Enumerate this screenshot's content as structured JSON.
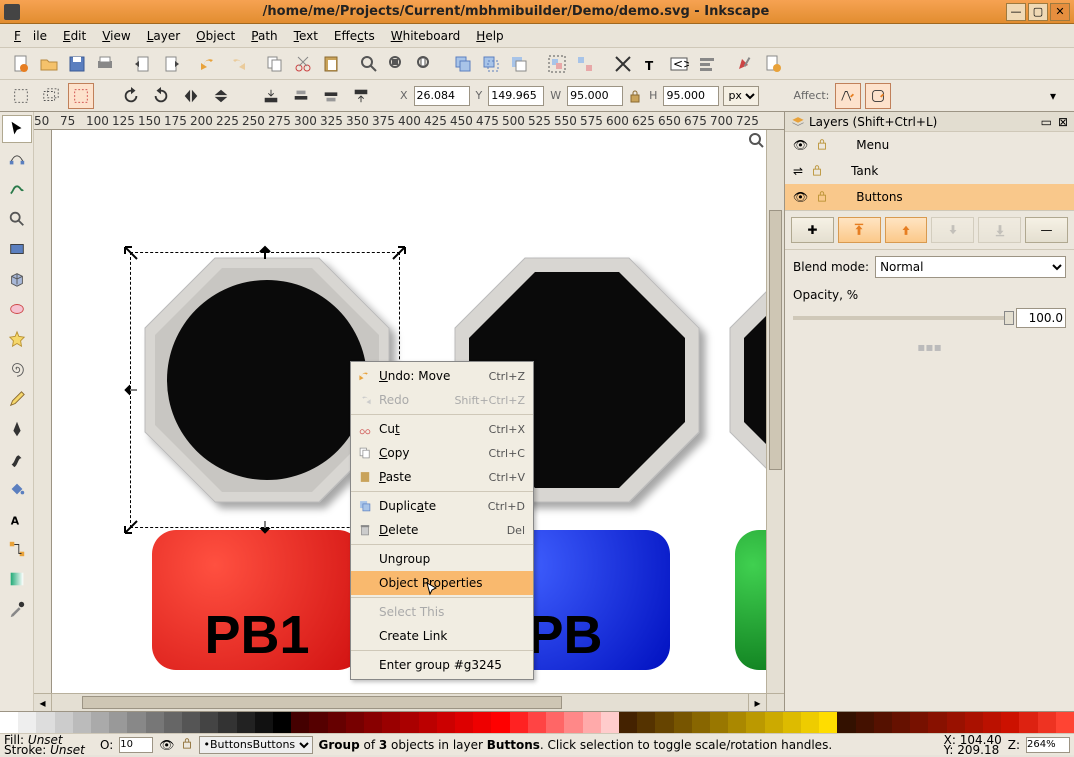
{
  "window": {
    "title": "/home/me/Projects/Current/mbhmibuilder/Demo/demo.svg - Inkscape"
  },
  "menu": {
    "file": "File",
    "edit": "Edit",
    "view": "View",
    "layer": "Layer",
    "object": "Object",
    "path": "Path",
    "text": "Text",
    "effects": "Effects",
    "whiteboard": "Whiteboard",
    "help": "Help"
  },
  "tb2": {
    "x_label": "X",
    "x_value": "26.084",
    "y_label": "Y",
    "y_value": "149.965",
    "w_label": "W",
    "w_value": "95.000",
    "h_label": "H",
    "h_value": "95.000",
    "unit": "px",
    "affect_label": "Affect:"
  },
  "layers_panel": {
    "title": "Layers (Shift+Ctrl+L)",
    "items": [
      {
        "name": "Menu"
      },
      {
        "name": "Tank"
      },
      {
        "name": "Buttons"
      }
    ],
    "blend_label": "Blend mode:",
    "blend_value": "Normal",
    "opacity_label": "Opacity, %",
    "opacity_value": "100.0"
  },
  "context_menu": {
    "undo": "Undo: Move",
    "undo_acc": "Ctrl+Z",
    "redo": "Redo",
    "redo_acc": "Shift+Ctrl+Z",
    "cut": "Cut",
    "cut_acc": "Ctrl+X",
    "copy": "Copy",
    "copy_acc": "Ctrl+C",
    "paste": "Paste",
    "paste_acc": "Ctrl+V",
    "duplicate": "Duplicate",
    "duplicate_acc": "Ctrl+D",
    "delete": "Delete",
    "delete_acc": "Del",
    "ungroup": "Ungroup",
    "object_properties": "Object Properties",
    "select_this": "Select This",
    "create_link": "Create Link",
    "enter_group": "Enter group #g3245"
  },
  "canvas": {
    "pb1": "PB1",
    "pb2": "PB"
  },
  "ruler_ticks": [
    "50",
    "75",
    "100",
    "125",
    "150",
    "175",
    "200",
    "225",
    "250",
    "275",
    "300",
    "325",
    "350",
    "375",
    "400",
    "425",
    "450",
    "475",
    "500",
    "525",
    "550",
    "575",
    "600",
    "625",
    "650",
    "675",
    "700",
    "725"
  ],
  "status": {
    "fill_label": "Fill:",
    "fill_value": "Unset",
    "stroke_label": "Stroke:",
    "stroke_value": "Unset",
    "opacity_label": "O:",
    "opacity_value": "10",
    "layer_value": "Buttons",
    "msg_prefix": "Group",
    "msg_of": " of ",
    "msg_count": "3",
    "msg_mid": " objects in layer ",
    "msg_layer": "Buttons",
    "msg_suffix": ". Click selection to toggle scale/rotation handles.",
    "x_label": "X:",
    "x_value": "104.40",
    "y_label": "Y:",
    "y_value": "209.18",
    "z_label": "Z:",
    "z_value": "264%"
  }
}
